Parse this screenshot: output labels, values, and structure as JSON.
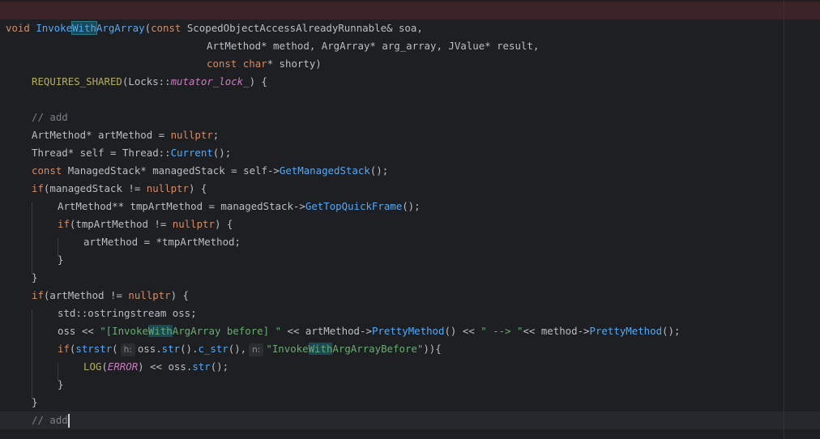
{
  "editor": {
    "language": "C++"
  },
  "code": {
    "l1": {
      "void": "void",
      "fn_a": "Invoke",
      "fn_match": "With",
      "fn_b": "ArgArray",
      "open": "(",
      "const": "const",
      "rest": " ScopedObjectAccessAlreadyRunnable& soa,"
    },
    "l2": "ArtMethod* method, ArgArray* arg_array, JValue* result,",
    "l3": {
      "const": "const",
      "char": "char",
      "rest": "* shorty)"
    },
    "l4": {
      "macro": "REQUIRES_SHARED",
      "a": "(Locks::",
      "field": "mutator_lock_",
      "b": ") {"
    },
    "l6": "// add",
    "l7": {
      "a": "ArtMethod* artMethod = ",
      "nullptr": "nullptr",
      "b": ";"
    },
    "l8": {
      "a": "Thread* self = Thread::",
      "fn": "Current",
      "b": "();"
    },
    "l9": {
      "const": "const",
      "a": " ManagedStack* managedStack = self->",
      "fn": "GetManagedStack",
      "b": "();"
    },
    "l10": {
      "if": "if",
      "a": "(managedStack != ",
      "nullptr": "nullptr",
      "b": ") {"
    },
    "l11": {
      "a": "ArtMethod** tmpArtMethod = managedStack->",
      "fn": "GetTopQuickFrame",
      "b": "();"
    },
    "l12": {
      "if": "if",
      "a": "(tmpArtMethod != ",
      "nullptr": "nullptr",
      "b": ") {"
    },
    "l13": "artMethod = *tmpArtMethod;",
    "l14": "}",
    "l15": "}",
    "l16": {
      "if": "if",
      "a": "(artMethod != ",
      "nullptr": "nullptr",
      "b": ") {"
    },
    "l17": "std::ostringstream oss;",
    "l18": {
      "a": "oss << ",
      "s1a": "\"[Invoke",
      "s1m": "With",
      "s1b": "ArgArray before] \"",
      "b": " << artMethod->",
      "fn1": "PrettyMethod",
      "c": "() << ",
      "s2": "\" --> \"",
      "d": "<< method->",
      "fn2": "PrettyMethod",
      "e": "();"
    },
    "l19": {
      "if": "if",
      "a": "(",
      "fn1": "strstr",
      "b": "(",
      "hint_h": "h:",
      "c": "oss.",
      "fn2": "str",
      "d": "().",
      "fn3": "c_str",
      "e": "(),",
      "hint_n": "n:",
      "s_a": "\"Invoke",
      "s_m": "With",
      "s_b": "ArgArrayBefore\"",
      "f": ")){"
    },
    "l20": {
      "macro": "LOG",
      "a": "(",
      "err": "ERROR",
      "b": ") << oss.",
      "fn": "str",
      "c": "();"
    },
    "l21": "}",
    "l22": "}",
    "l23": "// add"
  }
}
